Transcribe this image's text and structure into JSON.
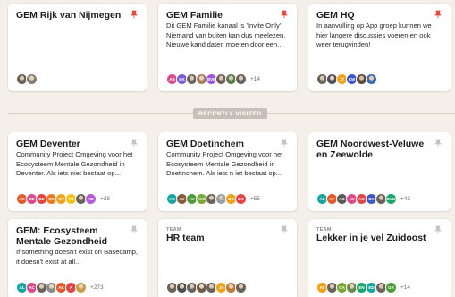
{
  "section_label": "RECENTLY VISITED",
  "pin_icon": "pin-icon",
  "colors": {
    "pin_active": "#e24b43",
    "pin_inactive": "#b9b3ad",
    "background": "#f4efe9",
    "badge": "#c8c0b8"
  },
  "pinned": [
    {
      "title": "GEM Rijk van Nijmegen",
      "desc": "",
      "more": ""
    },
    {
      "title": "GEM Familie",
      "desc": "Dit GEM Familie kanaal is 'Invite Only'. Niemand van buiten kan dus meelezen. Nieuwe kandidaten moeten door een...",
      "avatars": [
        "AB",
        "BK",
        "",
        "",
        "BVE",
        "",
        "",
        ""
      ],
      "more": "+14"
    },
    {
      "title": "GEM HQ",
      "desc": "In aanvulling op App groep kunnen we hier langere discussies voeren en ook weer terugvinden!",
      "avatars": [
        "",
        "",
        "JT",
        "KW",
        "",
        ""
      ],
      "more": ""
    }
  ],
  "recent": [
    {
      "title": "GEM Deventer",
      "desc": "Community Project Omgeving voor het Ecosysteem Mentale Gezondheid in Deventer. Als iets niet bestaat op...",
      "avatars": [
        "AK",
        "BE",
        "BE",
        "CK",
        "CV",
        "FE",
        "",
        "HB"
      ],
      "more": "+28"
    },
    {
      "title": "GEM Doetinchem",
      "desc": "Community Project Omgeving voor het Ecosysteem Mentale Gezondheid in Doetinchem. Als iets n iet bestaat op...",
      "avatars": [
        "AC",
        "AV",
        "AV",
        "AVO",
        "",
        "",
        "BC",
        "BK"
      ],
      "more": "+55"
    },
    {
      "title": "GEM Noordwest-Veluwe en Zeewolde",
      "desc": "",
      "avatars": [
        "AL",
        "AF",
        "AS",
        "AV",
        "AC",
        "BV",
        "",
        "BVM"
      ],
      "more": "+43"
    },
    {
      "title": "GEM: Ecosysteem Mentale Gezondheid",
      "desc": "If something doesn't exist on Basecamp, it doesn't exist at all...",
      "avatars": [
        "AL",
        "AC",
        "",
        "",
        "AK",
        "A",
        ""
      ],
      "more": "+273"
    },
    {
      "team_label": "TEAM",
      "title": "HR team",
      "desc": "",
      "avatars": [
        "",
        "",
        "",
        "",
        "",
        "JT",
        "",
        ""
      ],
      "more": ""
    },
    {
      "team_label": "TEAM",
      "title": "Lekker in je vel Zuidoost",
      "desc": "",
      "avatars": [
        "AV",
        "",
        "CA",
        "",
        "EN",
        "ED",
        "",
        "GR"
      ],
      "more": "+14"
    }
  ]
}
